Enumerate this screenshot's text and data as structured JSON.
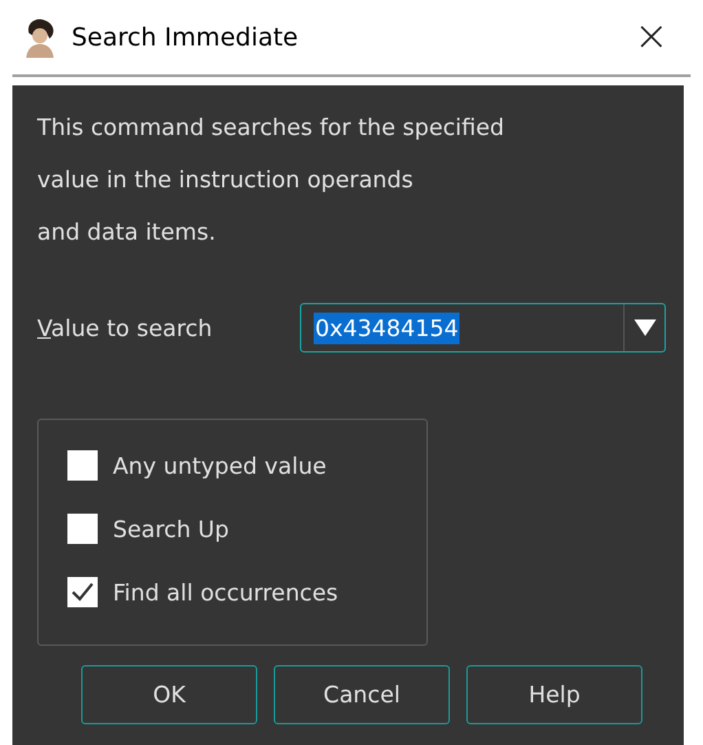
{
  "window": {
    "title": "Search Immediate",
    "close": "×"
  },
  "description": [
    "This command searches for the specified",
    "value in the instruction operands",
    "and data items."
  ],
  "value_field": {
    "label_mnemonic": "V",
    "label_rest": "alue to search",
    "value": "0x43484154",
    "selected_text": true
  },
  "options": [
    {
      "label": "Any untyped value",
      "checked": false
    },
    {
      "label": "Search Up",
      "checked": false
    },
    {
      "label": "Find all occurrences",
      "checked": true
    }
  ],
  "buttons": [
    "OK",
    "Cancel",
    "Help"
  ]
}
